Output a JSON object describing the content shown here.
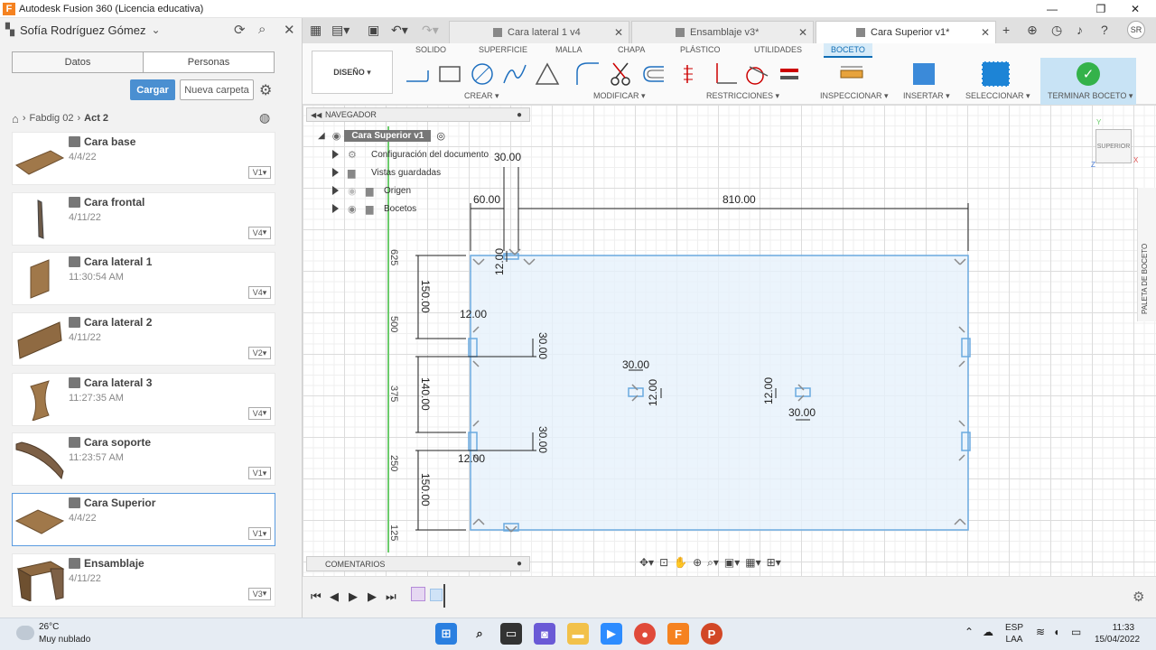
{
  "window": {
    "title": "Autodesk Fusion 360 (Licencia educativa)",
    "minimize": "—",
    "maximize": "❐",
    "close": "✕"
  },
  "data_panel": {
    "user": "Sofía Rodríguez Gómez",
    "tabs": [
      "Datos",
      "Personas"
    ],
    "upload_label": "Cargar",
    "new_folder_label": "Nueva carpeta",
    "breadcrumb": [
      "Fabdig 02",
      "Act 2"
    ],
    "files": [
      {
        "name": "Cara base",
        "date": "4/4/22",
        "version": "V1"
      },
      {
        "name": "Cara frontal",
        "date": "4/11/22",
        "version": "V4"
      },
      {
        "name": "Cara lateral 1",
        "date": "11:30:54 AM",
        "version": "V4"
      },
      {
        "name": "Cara lateral 2",
        "date": "4/11/22",
        "version": "V2"
      },
      {
        "name": "Cara lateral 3",
        "date": "11:27:35 AM",
        "version": "V4"
      },
      {
        "name": "Cara soporte",
        "date": "11:23:57 AM",
        "version": "V1"
      },
      {
        "name": "Cara Superior",
        "date": "4/4/22",
        "version": "V1"
      },
      {
        "name": "Ensamblaje",
        "date": "4/11/22",
        "version": "V3"
      }
    ]
  },
  "doc_tabs": [
    {
      "label": "Cara lateral 1 v4"
    },
    {
      "label": "Ensamblaje v3*"
    },
    {
      "label": "Cara Superior v1*"
    }
  ],
  "user_initials": "SR",
  "ribbon": {
    "tabs": [
      "SOLIDO",
      "SUPERFICIE",
      "MALLA",
      "CHAPA",
      "PLÁSTICO",
      "UTILIDADES",
      "BOCETO"
    ],
    "workspace": "DISEÑO ▾",
    "groups": [
      "CREAR ▾",
      "MODIFICAR ▾",
      "RESTRICCIONES ▾",
      "INSPECCIONAR ▾",
      "INSERTAR ▾",
      "SELECCIONAR ▾",
      "TERMINAR BOCETO ▾"
    ]
  },
  "navigator": {
    "title": "NAVEGADOR",
    "root": "Cara Superior v1",
    "items": [
      "Configuración del documento",
      "Vistas guardadas",
      "Origen",
      "Bocetos"
    ]
  },
  "comments_label": "COMENTARIOS",
  "viewcube_label": "SUPERIOR",
  "palette_label": "PALETA DE BOCETO",
  "dimensions": {
    "d30_top": "30.00",
    "d60": "60.00",
    "d810": "810.00",
    "d12_top": "12.00",
    "d150_top": "150.00",
    "d12_left_a": "12.00",
    "d30_right_a": "30.00",
    "d140": "140.00",
    "d30_right_b": "30.00",
    "d12_left_b": "12.00",
    "d150_bottom": "150.00",
    "d30_center_l": "30.00",
    "d12_center_l": "12.00",
    "d12_center_r": "12.00",
    "d30_center_r": "30.00"
  },
  "ruler": [
    "625",
    "500",
    "375",
    "250",
    "125"
  ],
  "taskbar": {
    "temperature": "26°C",
    "weather": "Muy nublado",
    "language_top": "ESP",
    "language_bottom": "LAA",
    "time": "11:33",
    "date": "15/04/2022"
  }
}
